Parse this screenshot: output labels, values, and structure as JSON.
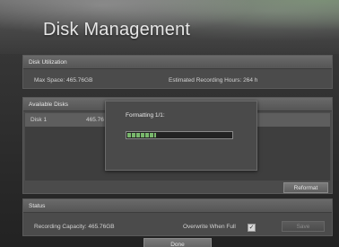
{
  "page": {
    "title": "Disk Management"
  },
  "utilization": {
    "header": "Disk Utilization",
    "max_space": "Max Space: 465.76GB",
    "estimated_hours": "Estimated Recording Hours: 264 h"
  },
  "available_disks": {
    "header": "Available Disks",
    "rows": [
      {
        "name": "Disk 1",
        "size": "465.76"
      }
    ],
    "reformat_label": "Reformat"
  },
  "dialog": {
    "text": "Formatting 1/1:",
    "progress_fraction": 0.28
  },
  "status": {
    "header": "Status",
    "recording_capacity": "Recording Capacity: 465.76GB",
    "overwrite_label": "Overwrite When Full",
    "overwrite_checked": true,
    "save_label": "Save"
  },
  "footer": {
    "done_label": "Done"
  },
  "colors": {
    "progress_fill": "#79b86c",
    "panel": "#4b4b4b"
  }
}
